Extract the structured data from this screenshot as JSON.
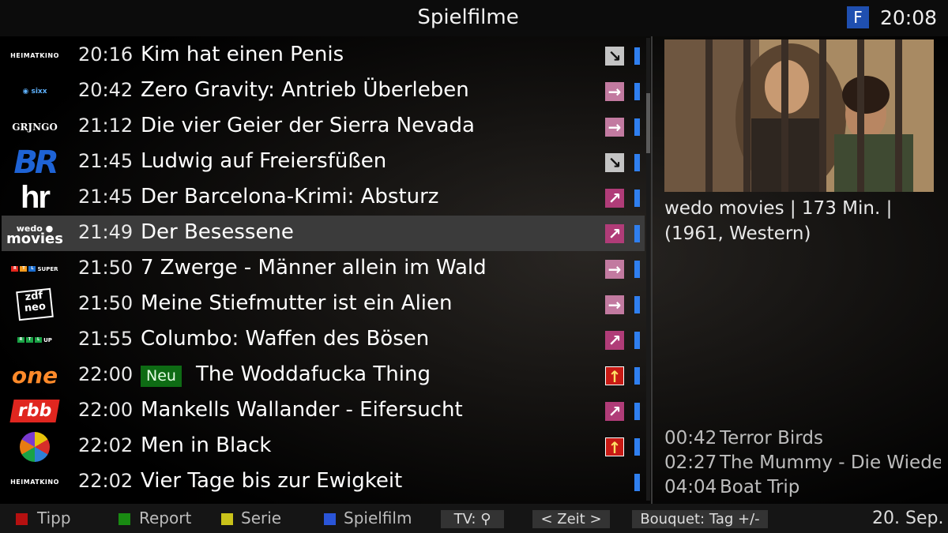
{
  "header": {
    "title": "Spielfilme",
    "badge": "F",
    "clock": "20:08"
  },
  "rows": [
    {
      "logo": "HEIMATKINO",
      "logo_icon": "heimatkino-logo",
      "time": "20:16",
      "title": "Kim hat einen Penis",
      "neu": "",
      "arrow": "gray",
      "arrow_glyph": "↘",
      "bluebar": true
    },
    {
      "logo": "sixx",
      "logo_icon": "sixx-logo",
      "time": "20:42",
      "title": "Zero Gravity: Antrieb Überleben",
      "neu": "",
      "arrow": "pink",
      "arrow_glyph": "→",
      "bluebar": true
    },
    {
      "logo": "GRJNGO",
      "logo_icon": "grjngo-logo",
      "time": "21:12",
      "title": "Die vier Geier der Sierra Nevada",
      "neu": "",
      "arrow": "pink",
      "arrow_glyph": "→",
      "bluebar": true
    },
    {
      "logo": "BR",
      "logo_icon": "br-logo",
      "time": "21:45",
      "title": "Ludwig auf Freiersfüßen",
      "neu": "",
      "arrow": "gray",
      "arrow_glyph": "↘",
      "bluebar": true
    },
    {
      "logo": "hr",
      "logo_icon": "hr-logo",
      "time": "21:45",
      "title": "Der Barcelona-Krimi: Absturz",
      "neu": "",
      "arrow": "magenta",
      "arrow_glyph": "↗",
      "bluebar": true
    },
    {
      "logo": "wedo movies",
      "logo_icon": "wedo-movies-logo",
      "time": "21:49",
      "title": "Der Besessene",
      "neu": "",
      "arrow": "magenta",
      "arrow_glyph": "↗",
      "bluebar": true,
      "selected": true
    },
    {
      "logo": "RTL SUPER",
      "logo_icon": "rtl-super-logo",
      "time": "21:50",
      "title": "7 Zwerge - Männer allein im Wald",
      "neu": "",
      "arrow": "pink",
      "arrow_glyph": "→",
      "bluebar": true
    },
    {
      "logo": "zdf neo",
      "logo_icon": "zdfneo-logo",
      "time": "21:50",
      "title": "Meine Stiefmutter ist ein Alien",
      "neu": "",
      "arrow": "pink",
      "arrow_glyph": "→",
      "bluebar": true
    },
    {
      "logo": "RTL UP",
      "logo_icon": "rtl-up-logo",
      "time": "21:55",
      "title": "Columbo: Waffen des Bösen",
      "neu": "",
      "arrow": "magenta",
      "arrow_glyph": "↗",
      "bluebar": true
    },
    {
      "logo": "one",
      "logo_icon": "one-logo",
      "time": "22:00",
      "title": "The Woddafucka Thing",
      "neu": "Neu",
      "arrow": "red",
      "arrow_glyph": "↑",
      "bluebar": true
    },
    {
      "logo": "rbb",
      "logo_icon": "rbb-logo",
      "time": "22:00",
      "title": "Mankells Wallander - Eifersucht",
      "neu": "",
      "arrow": "magenta",
      "arrow_glyph": "↗",
      "bluebar": true
    },
    {
      "logo": "",
      "logo_icon": "sat1-logo",
      "time": "22:02",
      "title": "Men in Black",
      "neu": "",
      "arrow": "red",
      "arrow_glyph": "↑",
      "bluebar": true
    },
    {
      "logo": "HEIMATKINO",
      "logo_icon": "heimatkino-logo",
      "time": "22:02",
      "title": "Vier Tage bis zur Ewigkeit",
      "neu": "",
      "arrow": "",
      "arrow_glyph": "",
      "bluebar": true
    }
  ],
  "detail": {
    "info_line1": "wedo movies | 173 Min. |",
    "info_line2": "(1961, Western)",
    "upcoming": [
      {
        "time": "00:42",
        "title": "Terror Birds"
      },
      {
        "time": "02:27",
        "title": "The Mummy - Die Wiedergeburt"
      },
      {
        "time": "04:04",
        "title": "Boat Trip"
      }
    ]
  },
  "footer": {
    "red_label": "Tipp",
    "green_label": "Report",
    "yellow_label": "Serie",
    "blue_label": "Spielfilm",
    "tv_label": "TV: ⚲",
    "zeit_label": "< Zeit >",
    "bouquet_label": "Bouquet: Tag +/-",
    "date": "20. Sep."
  },
  "colors": {
    "selected_row": "#3b3b3b",
    "accent_blue": "#2f7ff0",
    "neu_green": "#0e6b14"
  }
}
